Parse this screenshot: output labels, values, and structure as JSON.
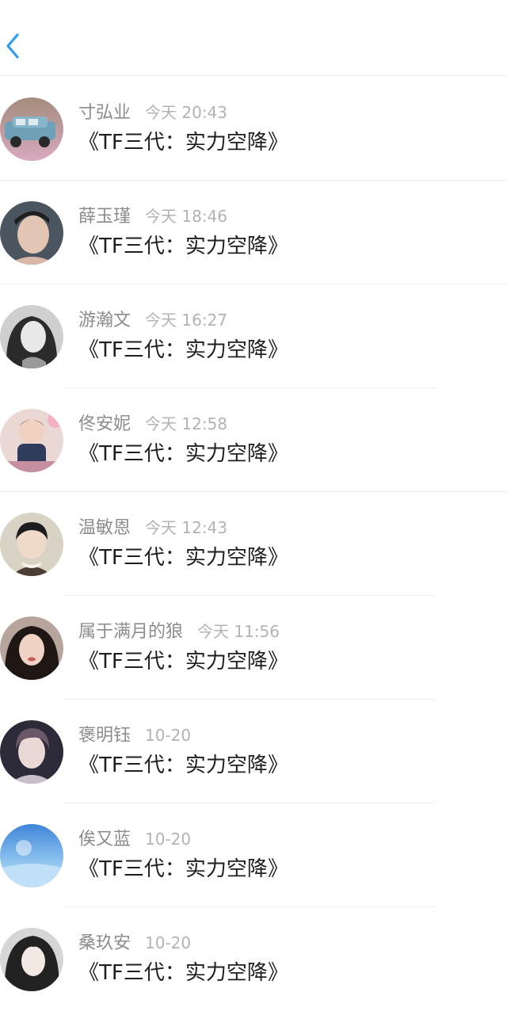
{
  "header": {
    "back_icon": "chevron-left-icon",
    "accent_color": "#2f9cf0"
  },
  "items": [
    {
      "name": "寸弘业",
      "time": "今天 20:43",
      "title": "《TF三代：实力空降》",
      "avatar": "toy-car-avatar"
    },
    {
      "name": "薛玉瑾",
      "time": "今天 18:46",
      "title": "《TF三代：实力空降》",
      "avatar": "man-portrait-avatar"
    },
    {
      "name": "游瀚文",
      "time": "今天 16:27",
      "title": "《TF三代：实力空降》",
      "avatar": "woman-bw-avatar"
    },
    {
      "name": "佟安妮",
      "time": "今天 12:58",
      "title": "《TF三代：实力空降》",
      "avatar": "toddler-avatar"
    },
    {
      "name": "温敏恩",
      "time": "今天 12:43",
      "title": "《TF三代：实力空降》",
      "avatar": "boy-avatar"
    },
    {
      "name": "属于满月的狼",
      "time": "今天 11:56",
      "title": "《TF三代：实力空降》",
      "avatar": "girl-avatar"
    },
    {
      "name": "褒明钰",
      "time": "10-20",
      "title": "《TF三代：实力空降》",
      "avatar": "young-man-avatar"
    },
    {
      "name": "俟又蓝",
      "time": "10-20",
      "title": "《TF三代：实力空降》",
      "avatar": "blue-scenery-avatar"
    },
    {
      "name": "桑玖安",
      "time": "10-20",
      "title": "《TF三代：实力空降》",
      "avatar": "anime-avatar"
    }
  ]
}
